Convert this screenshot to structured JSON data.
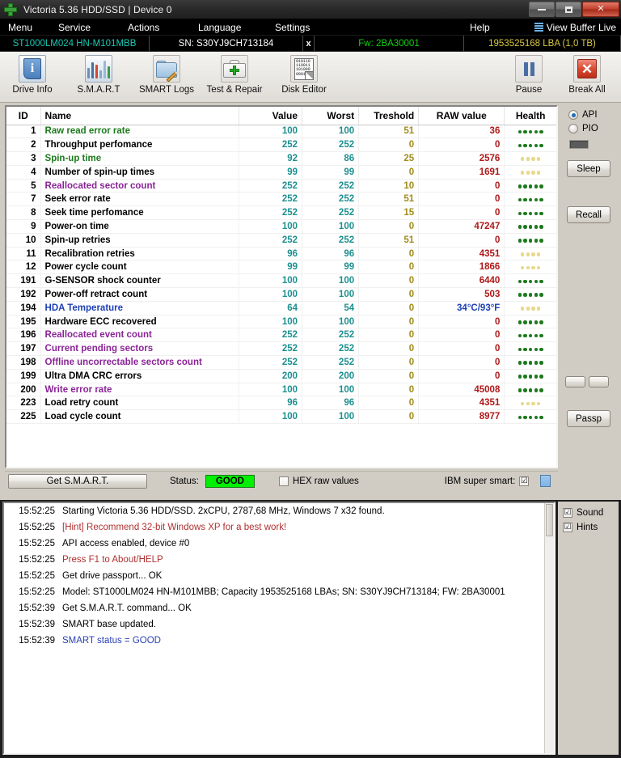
{
  "window": {
    "title": "Victoria 5.36 HDD/SSD | Device 0",
    "icon": "green-cross-icon",
    "minimize_label": "minimize-icon",
    "maximize_label": "maximize-icon",
    "close_label": "✕"
  },
  "menubar": {
    "items": [
      {
        "label": "Menu"
      },
      {
        "label": "Service"
      },
      {
        "label": "Actions"
      },
      {
        "label": "Language"
      },
      {
        "label": "Settings"
      },
      {
        "label": "Help"
      }
    ],
    "view_buffer_live": "View Buffer Live"
  },
  "drivebar": {
    "model": "ST1000LM024 HN-M101MBB",
    "serial": "SN: S30YJ9CH713184",
    "close_drive": "x",
    "firmware": "Fw: 2BA30001",
    "capacity": "1953525168 LBA (1,0 TB)",
    "colors": {
      "model": "#19c8b4",
      "firmware": "#12d012",
      "capacity": "#d8c840"
    }
  },
  "toolbar": {
    "buttons": [
      {
        "label": "Drive Info",
        "icon": "info-icon"
      },
      {
        "label": "S.M.A.R.T",
        "icon": "bar-chart-icon"
      },
      {
        "label": "SMART Logs",
        "icon": "folder-edit-icon"
      },
      {
        "label": "Test & Repair",
        "icon": "first-aid-kit-icon"
      },
      {
        "label": "Disk Editor",
        "icon": "hex-page-icon"
      }
    ],
    "right_buttons": [
      {
        "label": "Pause",
        "icon": "pause-icon"
      },
      {
        "label": "Break All",
        "icon": "red-x-icon"
      }
    ],
    "disk_editor_glyph_lines": [
      "010110",
      "110011",
      "101000",
      "0001"
    ]
  },
  "table": {
    "columns": [
      "ID",
      "Name",
      "Value",
      "Worst",
      "Treshold",
      "RAW value",
      "Health"
    ],
    "rows": [
      {
        "id": "1",
        "name": "Raw read error rate",
        "value": "100",
        "worst": "100",
        "threshold": "51",
        "raw": "36",
        "health": 5,
        "health_color": "#1c7a1c",
        "name_color": "#1b7a1b"
      },
      {
        "id": "2",
        "name": "Throughput perfomance",
        "value": "252",
        "worst": "252",
        "threshold": "0",
        "raw": "0",
        "health": 5,
        "health_color": "#1c7a1c",
        "name_color": "#000000"
      },
      {
        "id": "3",
        "name": "Spin-up time",
        "value": "92",
        "worst": "86",
        "threshold": "25",
        "raw": "2576",
        "health": 4,
        "health_color": "#e8d88a",
        "name_color": "#1b7a1b"
      },
      {
        "id": "4",
        "name": "Number of spin-up times",
        "value": "99",
        "worst": "99",
        "threshold": "0",
        "raw": "1691",
        "health": 4,
        "health_color": "#e8d88a",
        "name_color": "#000000"
      },
      {
        "id": "5",
        "name": "Reallocated sector count",
        "value": "252",
        "worst": "252",
        "threshold": "10",
        "raw": "0",
        "health": 5,
        "health_color": "#1c7a1c",
        "name_color": "#8a2496"
      },
      {
        "id": "7",
        "name": "Seek error rate",
        "value": "252",
        "worst": "252",
        "threshold": "51",
        "raw": "0",
        "health": 5,
        "health_color": "#1c7a1c",
        "name_color": "#000000"
      },
      {
        "id": "8",
        "name": "Seek time perfomance",
        "value": "252",
        "worst": "252",
        "threshold": "15",
        "raw": "0",
        "health": 5,
        "health_color": "#1c7a1c",
        "name_color": "#000000"
      },
      {
        "id": "9",
        "name": "Power-on time",
        "value": "100",
        "worst": "100",
        "threshold": "0",
        "raw": "47247",
        "health": 5,
        "health_color": "#1c7a1c",
        "name_color": "#000000"
      },
      {
        "id": "10",
        "name": "Spin-up retries",
        "value": "252",
        "worst": "252",
        "threshold": "51",
        "raw": "0",
        "health": 5,
        "health_color": "#1c7a1c",
        "name_color": "#000000"
      },
      {
        "id": "11",
        "name": "Recalibration retries",
        "value": "96",
        "worst": "96",
        "threshold": "0",
        "raw": "4351",
        "health": 4,
        "health_color": "#e8d88a",
        "name_color": "#000000"
      },
      {
        "id": "12",
        "name": "Power cycle count",
        "value": "99",
        "worst": "99",
        "threshold": "0",
        "raw": "1866",
        "health": 4,
        "health_color": "#e8d88a",
        "name_color": "#000000"
      },
      {
        "id": "191",
        "name": "G-SENSOR shock counter",
        "value": "100",
        "worst": "100",
        "threshold": "0",
        "raw": "6440",
        "health": 5,
        "health_color": "#1c7a1c",
        "name_color": "#000000"
      },
      {
        "id": "192",
        "name": "Power-off retract count",
        "value": "100",
        "worst": "100",
        "threshold": "0",
        "raw": "503",
        "health": 5,
        "health_color": "#1c7a1c",
        "name_color": "#000000"
      },
      {
        "id": "194",
        "name": "HDA Temperature",
        "value": "64",
        "worst": "54",
        "threshold": "0",
        "raw": "34°C/93°F",
        "health": 4,
        "health_color": "#e8d88a",
        "name_color": "#1d3fb5",
        "raw_color": "#1d3fb5"
      },
      {
        "id": "195",
        "name": "Hardware ECC recovered",
        "value": "100",
        "worst": "100",
        "threshold": "0",
        "raw": "0",
        "health": 5,
        "health_color": "#1c7a1c",
        "name_color": "#000000"
      },
      {
        "id": "196",
        "name": "Reallocated event count",
        "value": "252",
        "worst": "252",
        "threshold": "0",
        "raw": "0",
        "health": 5,
        "health_color": "#1c7a1c",
        "name_color": "#8a2496"
      },
      {
        "id": "197",
        "name": "Current pending sectors",
        "value": "252",
        "worst": "252",
        "threshold": "0",
        "raw": "0",
        "health": 5,
        "health_color": "#1c7a1c",
        "name_color": "#8a2496"
      },
      {
        "id": "198",
        "name": "Offline uncorrectable sectors count",
        "value": "252",
        "worst": "252",
        "threshold": "0",
        "raw": "0",
        "health": 5,
        "health_color": "#1c7a1c",
        "name_color": "#8a2496"
      },
      {
        "id": "199",
        "name": "Ultra DMA CRC errors",
        "value": "200",
        "worst": "200",
        "threshold": "0",
        "raw": "0",
        "health": 5,
        "health_color": "#1c7a1c",
        "name_color": "#000000"
      },
      {
        "id": "200",
        "name": "Write error rate",
        "value": "100",
        "worst": "100",
        "threshold": "0",
        "raw": "45008",
        "health": 5,
        "health_color": "#1c7a1c",
        "name_color": "#8a2496"
      },
      {
        "id": "223",
        "name": "Load retry count",
        "value": "96",
        "worst": "96",
        "threshold": "0",
        "raw": "4351",
        "health": 4,
        "health_color": "#e8d88a",
        "name_color": "#000000"
      },
      {
        "id": "225",
        "name": "Load cycle count",
        "value": "100",
        "worst": "100",
        "threshold": "0",
        "raw": "8977",
        "health": 5,
        "health_color": "#1c7a1c",
        "name_color": "#000000"
      }
    ]
  },
  "side_panel": {
    "api_label": "API",
    "api_selected": true,
    "pio_label": "PIO",
    "pio_selected": false,
    "indicator": "led-indicator",
    "sleep_label": "Sleep",
    "recall_label": "Recall",
    "small_buttons": [
      {
        "label": ""
      },
      {
        "label": ""
      }
    ],
    "passp_label": "Passp"
  },
  "status_strip": {
    "get_smart_label": "Get S.M.A.R.T.",
    "status_label": "Status:",
    "status_value": "GOOD",
    "status_color": "#00f000",
    "hex_label": "HEX raw values",
    "hex_checked": false,
    "ibm_label": "IBM super smart:",
    "ibm_checked": true,
    "ibm_check_glyph": "☑",
    "blue_box": "blue-indicator"
  },
  "log": {
    "entries": [
      {
        "time": "15:52:25",
        "msg": "Starting Victoria 5.36 HDD/SSD. 2xCPU, 2787,68 MHz, Windows 7 x32 found.",
        "color": "#000000"
      },
      {
        "time": "15:52:25",
        "msg": "[Hint] Recommend 32-bit Windows XP for a best work!",
        "color": "#b03030"
      },
      {
        "time": "15:52:25",
        "msg": "API access enabled, device #0",
        "color": "#000000"
      },
      {
        "time": "15:52:25",
        "msg": "Press F1 to About/HELP",
        "color": "#b03030"
      },
      {
        "time": "15:52:25",
        "msg": "Get drive passport... OK",
        "color": "#000000"
      },
      {
        "time": "15:52:25",
        "msg": "Model: ST1000LM024 HN-M101MBB; Capacity 1953525168 LBAs; SN: S30YJ9CH713184; FW: 2BA30001",
        "color": "#000000"
      },
      {
        "time": "15:52:39",
        "msg": "Get S.M.A.R.T. command... OK",
        "color": "#000000"
      },
      {
        "time": "15:52:39",
        "msg": "SMART base updated.",
        "color": "#000000"
      },
      {
        "time": "15:52:39",
        "msg": "SMART status = GOOD",
        "color": "#2a3fb5"
      }
    ],
    "side": {
      "sound_label": "Sound",
      "sound_checked": true,
      "hints_label": "Hints",
      "hints_checked": true,
      "check_glyph": "☑"
    }
  }
}
